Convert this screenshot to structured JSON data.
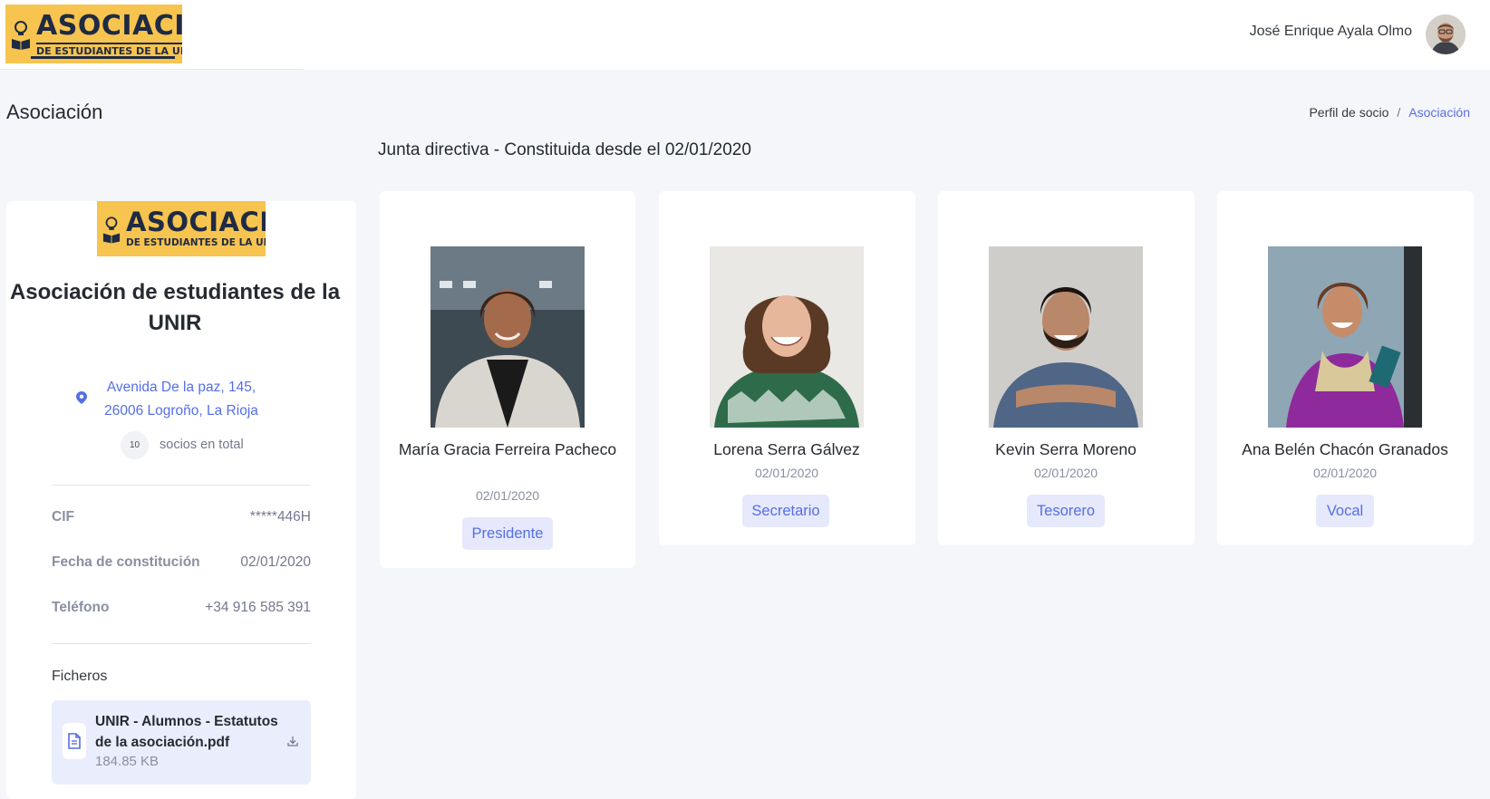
{
  "brand": {
    "logo_line1": "ASOCIACIÓN",
    "logo_line2": "DE ESTUDIANTES DE LA UNIR",
    "color": "#f6c44f"
  },
  "header": {
    "user_name": "José Enrique Ayala Olmo"
  },
  "page": {
    "title": "Asociación",
    "breadcrumb": [
      "Perfil de socio",
      "/",
      "Asociación"
    ],
    "accent_color": "#556ee6"
  },
  "association": {
    "name": "Asociación de estudiantes de la UNIR",
    "address": "Avenida De la paz, 145, 26006 Logroño, La Rioja",
    "member_count": "10",
    "member_count_label": "socios en total",
    "details": [
      {
        "label": "CIF",
        "value": "*****446H"
      },
      {
        "label": "Fecha de constitución",
        "value": "02/01/2020"
      },
      {
        "label": "Teléfono",
        "value": "+34 916 585 391"
      }
    ],
    "files_heading": "Ficheros",
    "file": {
      "name": "UNIR - Alumnos - Estatutos de la asociación.pdf",
      "size": "184.85 KB",
      "icon": "file-document-icon",
      "action_icon": "download-icon"
    }
  },
  "board": {
    "title": "Junta directiva - Constituida desde el 02/01/2020",
    "members": [
      {
        "name": "María Gracia Ferreira Pacheco",
        "date": "02/01/2020",
        "role": "Presidente"
      },
      {
        "name": "Lorena Serra Gálvez",
        "date": "02/01/2020",
        "role": "Secretario"
      },
      {
        "name": "Kevin Serra Moreno",
        "date": "02/01/2020",
        "role": "Tesorero"
      },
      {
        "name": "Ana Belén Chacón Granados",
        "date": "02/01/2020",
        "role": "Vocal"
      }
    ]
  }
}
